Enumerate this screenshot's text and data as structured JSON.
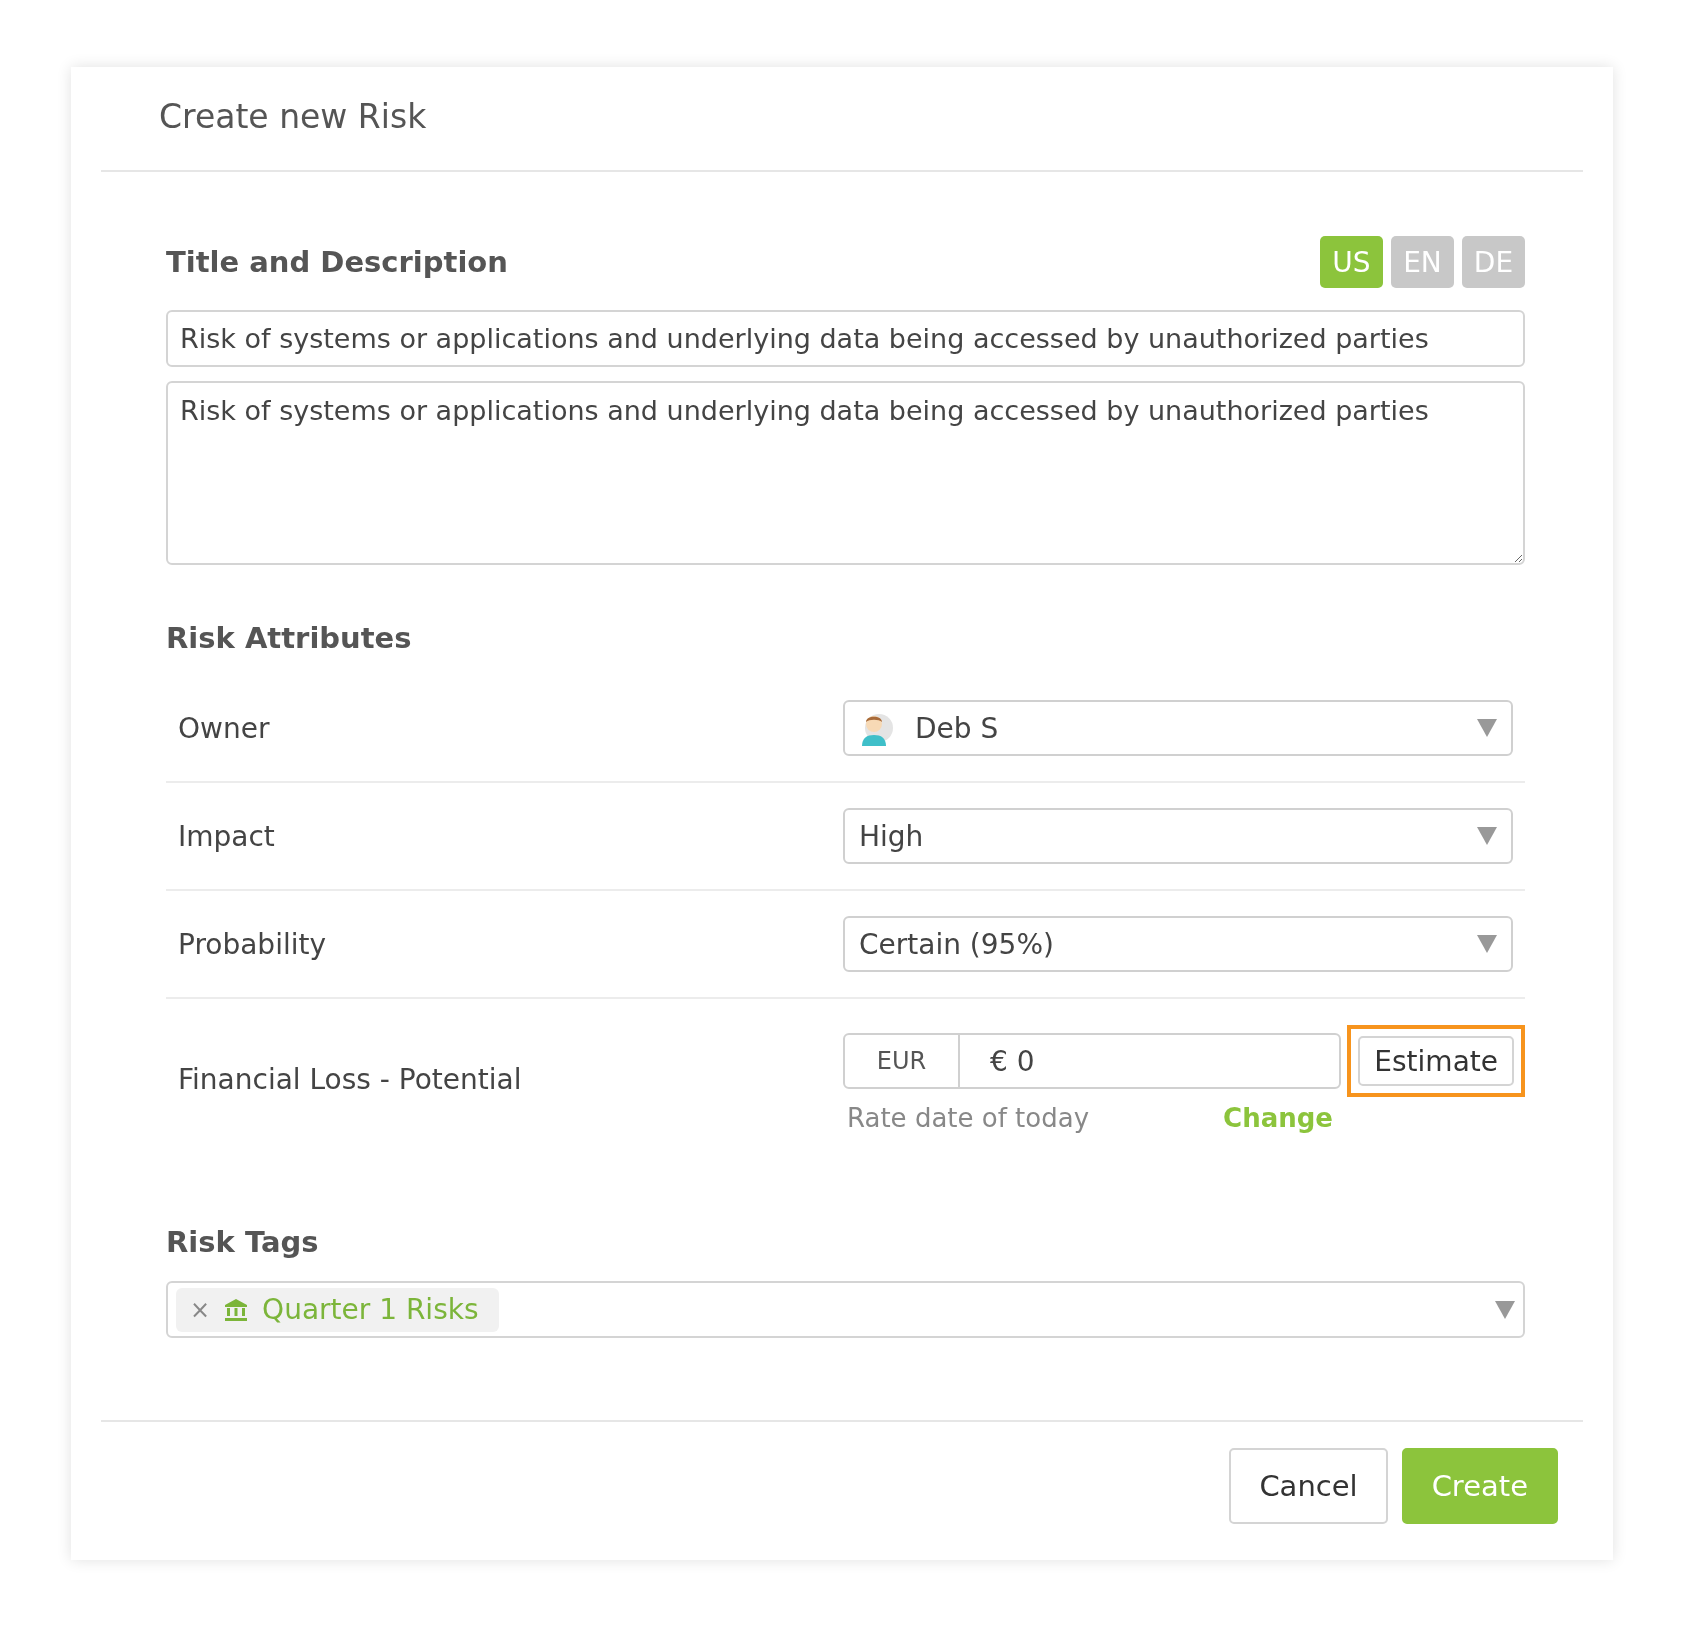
{
  "dialog": {
    "title": "Create new Risk"
  },
  "title_section": {
    "heading": "Title and Description",
    "languages": [
      {
        "label": "US",
        "selected": true
      },
      {
        "label": "EN",
        "selected": false
      },
      {
        "label": "DE",
        "selected": false
      }
    ],
    "title_value": "Risk of systems or applications and underlying data being accessed by unauthorized parties",
    "description_value": "Risk of systems or applications and underlying data being accessed by unauthorized parties"
  },
  "attributes": {
    "heading": "Risk Attributes",
    "rows": [
      {
        "kind": "select",
        "label": "Owner",
        "value": "Deb S",
        "avatar": true
      },
      {
        "kind": "select",
        "label": "Impact",
        "value": "High",
        "avatar": false
      },
      {
        "kind": "select",
        "label": "Probability",
        "value": "Certain (95%)",
        "avatar": false
      },
      {
        "kind": "money",
        "label": "Financial Loss - Potential",
        "currency": "EUR",
        "value": "€ 0",
        "button": "Estimate",
        "highlighted": true,
        "note": "Rate date of today",
        "link": "Change"
      }
    ]
  },
  "tags": {
    "heading": "Risk Tags",
    "items": [
      {
        "label": "Quarter 1 Risks"
      }
    ],
    "remove": "×"
  },
  "buttons": {
    "cancel": "Cancel",
    "create": "Create"
  }
}
